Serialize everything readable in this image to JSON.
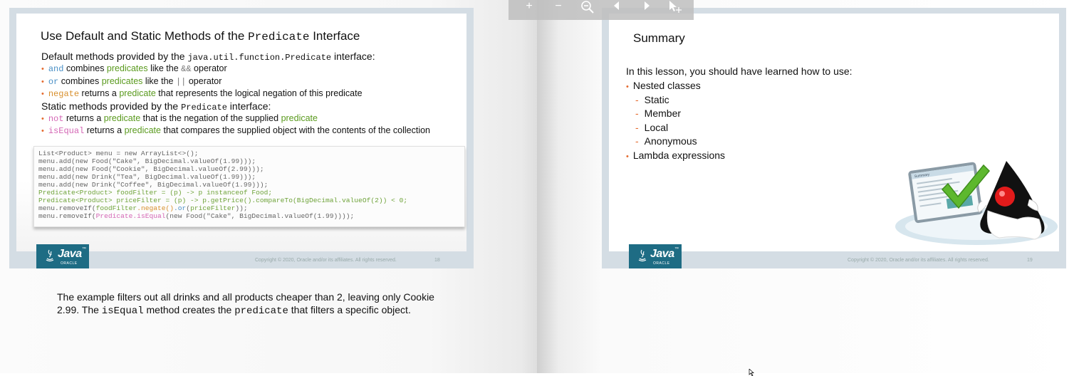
{
  "toolbar": {
    "zoom_in": "+",
    "zoom_out": "−",
    "zoom_fit_icon": "magnifier-minus-icon",
    "prev_icon": "arrow-left-icon",
    "next_icon": "arrow-right-icon",
    "select_icon": "pointer-move-icon"
  },
  "slide18": {
    "title_prefix": "Use Default and Static Methods of the ",
    "title_code": "Predicate",
    "title_suffix": " Interface",
    "default_head_prefix": "Default methods provided by the ",
    "default_head_code": "java.util.function.Predicate",
    "default_head_suffix": " interface:",
    "b1": {
      "kw": "and",
      "t1": " combines ",
      "k2": "predicates",
      "t2": " like the ",
      "op": "&&",
      "t3": " operator"
    },
    "b2": {
      "kw": "or",
      "t1": " combines ",
      "k2": "predicates",
      "t2": " like the ",
      "op": "||",
      "t3": " operator"
    },
    "b3": {
      "kw": "negate",
      "t1": " returns a ",
      "k2": "predicate",
      "t2": " that represents the logical negation of this predicate"
    },
    "static_head_prefix": "Static methods provided by the ",
    "static_head_code": "Predicate",
    "static_head_suffix": " interface:",
    "b4": {
      "kw": "not",
      "t1": " returns a ",
      "k2": "predicate",
      "t2": " that is the negation of the supplied ",
      "k3": "predicate"
    },
    "b5": {
      "kw": "isEqual",
      "t1": " returns a ",
      "k2": "predicate",
      "t2": " that compares the supplied object with the contents of the collection"
    },
    "code": {
      "l1": "List<Product> menu = new ArrayList<>();",
      "l2": "menu.add(new Food(\"Cake\", BigDecimal.valueOf(1.99)));",
      "l3": "menu.add(new Food(\"Cookie\", BigDecimal.valueOf(2.99)));",
      "l4": "menu.add(new Drink(\"Tea\", BigDecimal.valueOf(1.99)));",
      "l5": "menu.add(new Drink(\"Coffee\", BigDecimal.valueOf(1.99)));",
      "l6": "Predicate<Product> foodFilter = (p) -> p instanceof Food;",
      "l7": "Predicate<Product> priceFilter = (p) -> p.getPrice().compareTo(BigDecimal.valueOf(2)) < 0;",
      "l8a": "menu.removeIf(",
      "l8b": "foodFilter",
      "l8c": ".negate()",
      "l8d": ".or",
      "l8e": "(",
      "l8f": "priceFilter",
      "l8g": "));",
      "l9a": "menu.removeIf(",
      "l9b": "Predicate.isEqual",
      "l9c": "(new Food(\"Cake\", BigDecimal.valueOf(1.99))));"
    },
    "copyright": "Copyright © 2020, Oracle and/or its affiliates. All rights reserved.",
    "page_number": "18"
  },
  "notes": {
    "p1": "The example filters out all drinks and all products cheaper than 2, leaving only Cookie 2.99. The ",
    "code1": "isEqual",
    "p2": " method creates the ",
    "code2": "predicate",
    "p3": " that filters a specific object."
  },
  "slide19": {
    "title": "Summary",
    "intro": "In this lesson, you should have learned how to use:",
    "item1": "Nested classes",
    "sub1": "Static",
    "sub2": "Member",
    "sub3": "Local",
    "sub4": "Anonymous",
    "item2": "Lambda expressions",
    "illus_screen_title": "Summary",
    "copyright": "Copyright © 2020, Oracle and/or its affiliates. All rights reserved.",
    "page_number": "19"
  },
  "logo": {
    "word": "Java",
    "tm": "™",
    "oracle": "ORACLE"
  },
  "colors": {
    "accent_orange": "#e56b2f",
    "keyword_blue": "#4a90c6",
    "keyword_green": "#5a9a1e",
    "keyword_pink": "#d466b5",
    "java_logo_bg": "#1e6c84",
    "frame": "#d4dde4"
  }
}
